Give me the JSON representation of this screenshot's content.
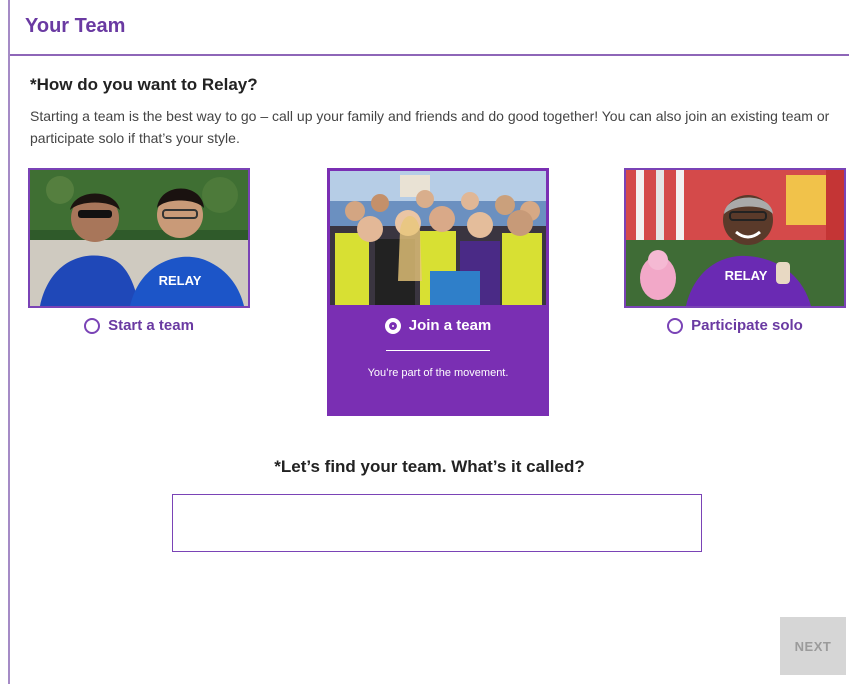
{
  "header": {
    "title": "Your Team"
  },
  "question": {
    "title": "*How do you want to Relay?",
    "description": "Starting a team is the best way to go – call up your family and friends and do good together! You can also join an existing team or participate solo if that’s your style."
  },
  "options": [
    {
      "label": "Start a team",
      "selected": false
    },
    {
      "label": "Join a team",
      "selected": true,
      "tagline": "You’re part of the movement."
    },
    {
      "label": "Participate solo",
      "selected": false
    }
  ],
  "team_search": {
    "question": "*Let’s find your team. What’s it called?",
    "value": "",
    "placeholder": ""
  },
  "next_button": {
    "label": "NEXT",
    "enabled": false
  },
  "colors": {
    "accent": "#7a2fb3",
    "heading": "#6a3aa2",
    "disabled": "#d6d6d6"
  }
}
